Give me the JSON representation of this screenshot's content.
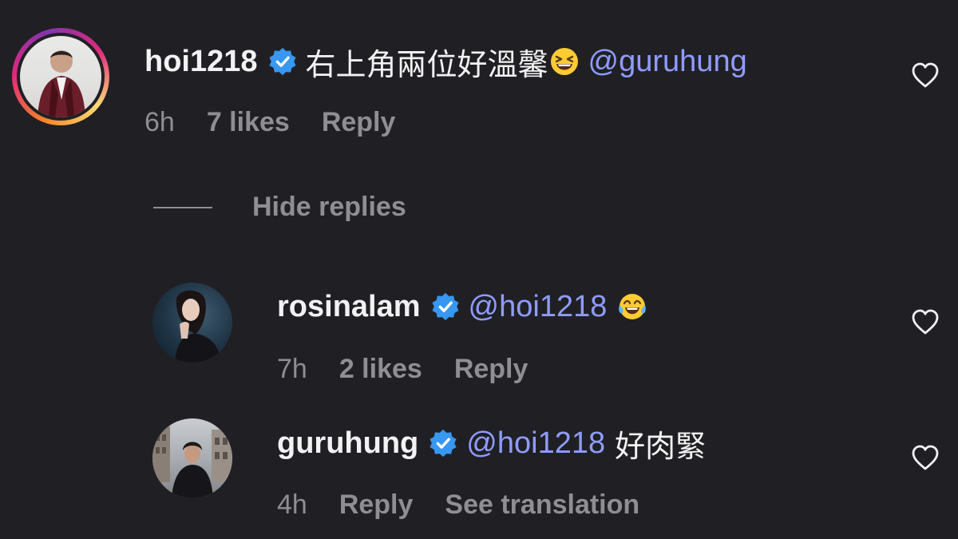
{
  "comments": [
    {
      "username": "hoi1218",
      "text": "右上角兩位好溫馨",
      "emoji": "grinning-squinting-face",
      "mention": "@guruhung",
      "time": "6h",
      "likes": "7 likes",
      "reply": "Reply"
    }
  ],
  "hide_replies": "Hide replies",
  "replies": [
    {
      "username": "rosinalam",
      "mention": "@hoi1218",
      "emoji": "face-with-tears-of-joy",
      "time": "7h",
      "likes": "2 likes",
      "reply": "Reply"
    },
    {
      "username": "guruhung",
      "mention": "@hoi1218",
      "text": "好肉緊",
      "time": "4h",
      "reply": "Reply",
      "see_translation": "See translation"
    }
  ],
  "colors": {
    "background": "#202024",
    "mention": "#8f9cff",
    "verified": "#3897f0",
    "muted": "#8e8e93"
  },
  "icons": [
    "verified-badge-icon",
    "heart-icon"
  ]
}
